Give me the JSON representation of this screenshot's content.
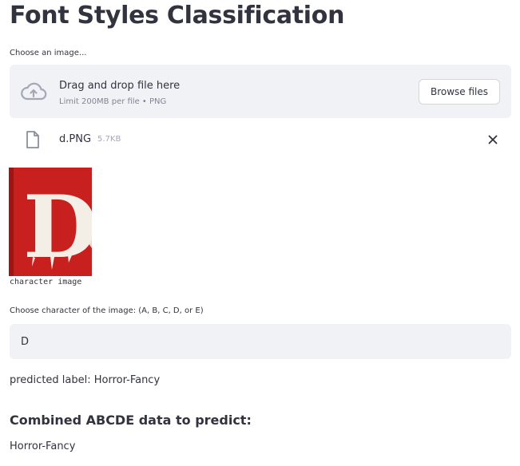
{
  "title": "Font Styles Classification",
  "uploader": {
    "label": "Choose an image...",
    "drop_text": "Drag and drop file here",
    "limit_text": "Limit 200MB per file • PNG",
    "browse_label": "Browse files",
    "icon": "cloud-upload-icon"
  },
  "file": {
    "name": "d.PNG",
    "size": "5.7KB",
    "icon": "file-icon",
    "remove_icon": "close-icon"
  },
  "image": {
    "caption": "character image",
    "glyph": "D",
    "background": "#c8201e"
  },
  "character_field": {
    "label": "Choose character of the image: (A, B, C, D, or E)",
    "value": "D"
  },
  "prediction": {
    "text": "predicted label: Horror-Fancy"
  },
  "combined": {
    "heading": "Combined ABCDE data to predict:",
    "result": "Horror-Fancy"
  },
  "colors": {
    "text": "#31333f",
    "panel": "#f0f2f6",
    "muted": "#808495"
  }
}
